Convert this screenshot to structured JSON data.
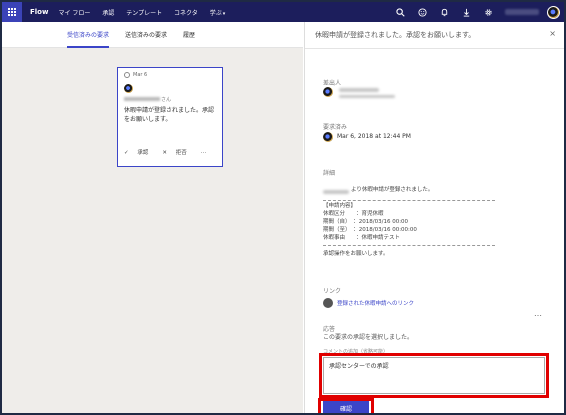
{
  "topbar": {
    "brand": "Flow",
    "nav": [
      "マイ フロー",
      "承認",
      "テンプレート",
      "コネクタ",
      "学ぶ"
    ],
    "icons": [
      "search-icon",
      "smiley-icon",
      "bell-icon",
      "download-icon",
      "gear-icon"
    ]
  },
  "tabs": {
    "received": "受信済みの要求",
    "sent": "送信済みの要求",
    "history": "履歴"
  },
  "card": {
    "date": "Mar 6",
    "sender_suffix": "さん",
    "message": "休暇申請が登録されました。承認をお願いします。",
    "approve": "承認",
    "reject": "拒否",
    "more": "…"
  },
  "panel": {
    "title": "休暇申請が登録されました。承認をお願いします。",
    "close": "×",
    "sender_label": "差出人",
    "requested_label": "要求済み",
    "requested_date": "Mar 6, 2018 at 12:44 PM",
    "details_label": "詳細",
    "details_intro": "より休暇申請が登録されました。",
    "details_header": "【申請内容】",
    "details_lines": [
      "休暇区分　　：育児休暇",
      "期間（自）　：2018/03/16 00:00",
      "期間（至）　：2018/03/16 00:00:00",
      "休暇事由　　：休暇申請テスト"
    ],
    "details_footer": "承認操作をお願いします。",
    "link_label": "リンク",
    "link_text": "登録された休暇申請へのリンク",
    "response_label": "応答",
    "response_prompt": "この要求の承認を選択しました。",
    "comment_label": "コメントの追加（省略可能）",
    "comment_value": "承認センターでの承認",
    "confirm": "確認"
  }
}
